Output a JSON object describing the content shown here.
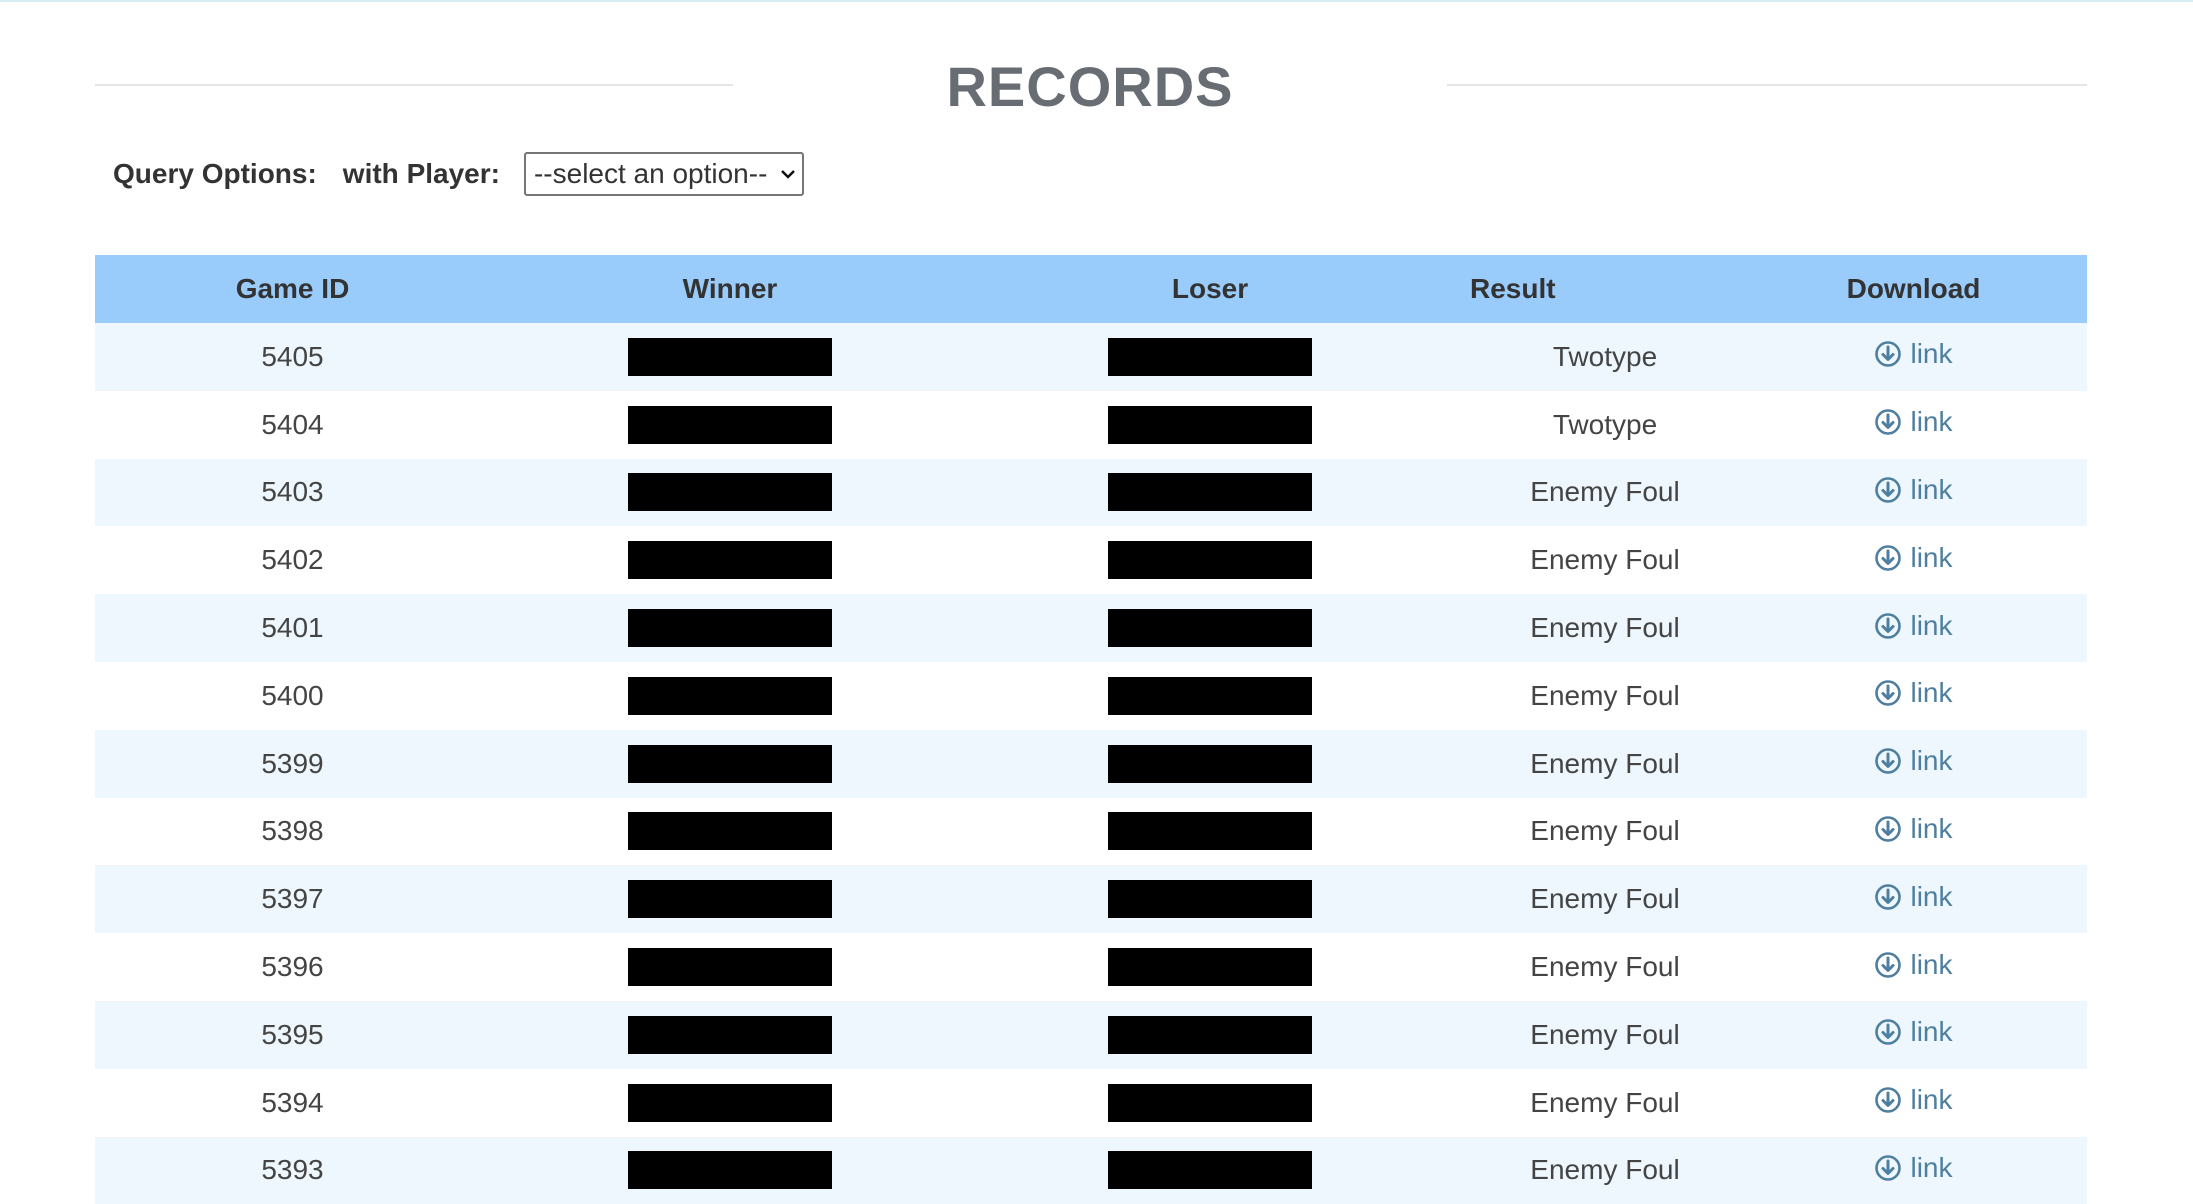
{
  "page": {
    "title": "RECORDS"
  },
  "query": {
    "label": "Query Options:",
    "player_label": "with Player:",
    "player_select": "--select an option--"
  },
  "table": {
    "columns": [
      "Game ID",
      "Winner",
      "Loser",
      "Result",
      "Download"
    ],
    "rows": [
      {
        "game_id": "5405",
        "result": "Twotype",
        "download": "link"
      },
      {
        "game_id": "5404",
        "result": "Twotype",
        "download": "link"
      },
      {
        "game_id": "5403",
        "result": "Enemy Foul",
        "download": "link"
      },
      {
        "game_id": "5402",
        "result": "Enemy Foul",
        "download": "link"
      },
      {
        "game_id": "5401",
        "result": "Enemy Foul",
        "download": "link"
      },
      {
        "game_id": "5400",
        "result": "Enemy Foul",
        "download": "link"
      },
      {
        "game_id": "5399",
        "result": "Enemy Foul",
        "download": "link"
      },
      {
        "game_id": "5398",
        "result": "Enemy Foul",
        "download": "link"
      },
      {
        "game_id": "5397",
        "result": "Enemy Foul",
        "download": "link"
      },
      {
        "game_id": "5396",
        "result": "Enemy Foul",
        "download": "link"
      },
      {
        "game_id": "5395",
        "result": "Enemy Foul",
        "download": "link"
      },
      {
        "game_id": "5394",
        "result": "Enemy Foul",
        "download": "link"
      },
      {
        "game_id": "5393",
        "result": "Enemy Foul",
        "download": "link"
      }
    ]
  },
  "icons": {
    "download": "download-circle-icon",
    "select_arrow": "chevron-down-icon"
  },
  "colors": {
    "header_bg": "#99cbfb",
    "row_alt_bg": "#edf7fd",
    "link": "#4e7fa0",
    "title": "#676d72"
  }
}
